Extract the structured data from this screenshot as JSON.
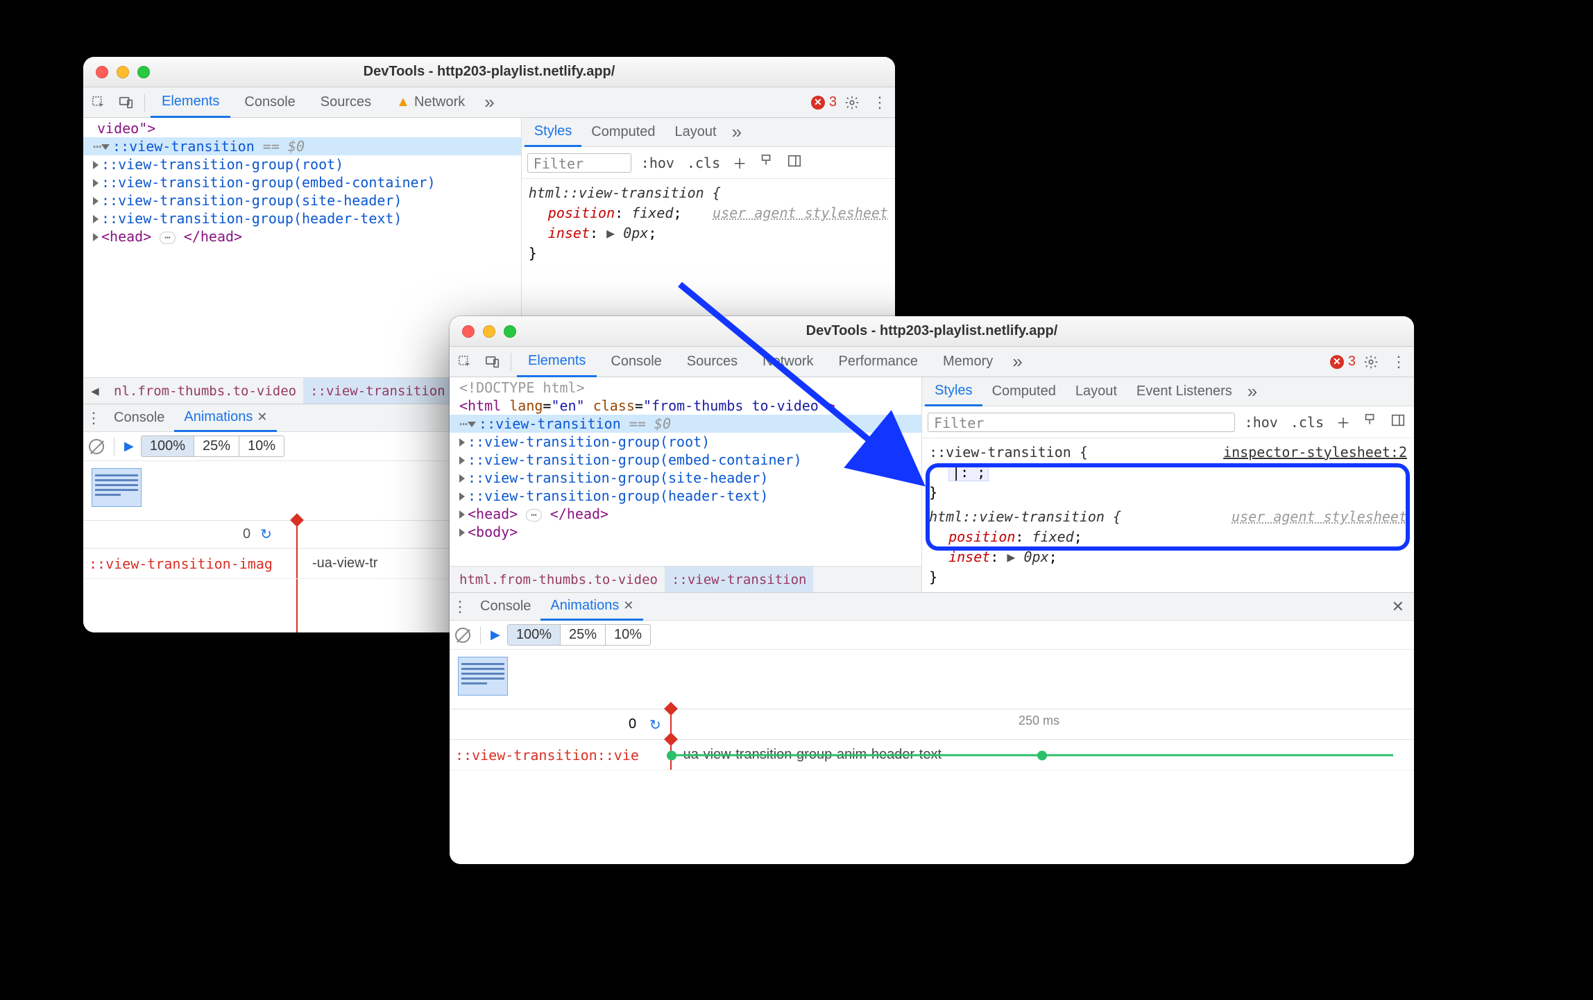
{
  "win1": {
    "title": "DevTools - http203-playlist.netlify.app/",
    "tabs": {
      "elements": "Elements",
      "console": "Console",
      "sources": "Sources",
      "network": "Network"
    },
    "errors": "3",
    "dom": {
      "video_end": "video\">",
      "vt": "::view-transition",
      "dollar": "== $0",
      "g_root": "::view-transition-group(root)",
      "g_embed": "::view-transition-group(embed-container)",
      "g_site": "::view-transition-group(site-header)",
      "g_header": "::view-transition-group(header-text)",
      "head_open": "<head>",
      "head_close": "</head>"
    },
    "crumbs": {
      "c1": "nl.from-thumbs.to-video",
      "c2": "::view-transition"
    },
    "styles": {
      "tab_styles": "Styles",
      "tab_computed": "Computed",
      "tab_layout": "Layout",
      "filter": "Filter",
      "hov": ":hov",
      "cls": ".cls",
      "rule_sel": "html::view-transition {",
      "src": "user agent stylesheet",
      "p1": "position",
      "v1": "fixed",
      "p2": "inset",
      "v2": "0px",
      "close": "}"
    },
    "drawer": {
      "console": "Console",
      "anim": "Animations",
      "seg100": "100%",
      "seg25": "25%",
      "seg10": "10%",
      "zero": "0",
      "row_left": "::view-transition-imag",
      "row_anim": "-ua-view-tr"
    }
  },
  "win2": {
    "title": "DevTools - http203-playlist.netlify.app/",
    "tabs": {
      "elements": "Elements",
      "console": "Console",
      "sources": "Sources",
      "network": "Network",
      "performance": "Performance",
      "memory": "Memory"
    },
    "errors": "3",
    "dom": {
      "doctype": "<!DOCTYPE html>",
      "html_open1": "<html ",
      "lang_attr": "lang",
      "lang_val": "\"en\"",
      "class_attr": "class",
      "class_val": "\"from-thumbs to-video\"",
      "html_open2": ">",
      "vt": "::view-transition",
      "dollar": "== $0",
      "g_root": "::view-transition-group(root)",
      "g_embed": "::view-transition-group(embed-container)",
      "g_site": "::view-transition-group(site-header)",
      "g_header": "::view-transition-group(header-text)",
      "head_open": "<head>",
      "head_close": "</head>",
      "body_open": "<body>"
    },
    "crumbs": {
      "c1": "html.from-thumbs.to-video",
      "c2": "::view-transition"
    },
    "styles": {
      "tab_styles": "Styles",
      "tab_computed": "Computed",
      "tab_layout": "Layout",
      "tab_el": "Event Listeners",
      "filter": "Filter",
      "hov": ":hov",
      "cls": ".cls",
      "r1_sel": "::view-transition {",
      "r1_src": "inspector-stylesheet:2",
      "r1_empty": "|:  ;",
      "r1_close": "}",
      "r2_sel": "html::view-transition {",
      "r2_src": "user agent stylesheet",
      "p1": "position",
      "v1": "fixed",
      "p2": "inset",
      "v2": "0px",
      "close": "}"
    },
    "drawer": {
      "console": "Console",
      "anim": "Animations",
      "seg100": "100%",
      "seg25": "25%",
      "seg10": "10%",
      "zero": "0",
      "tick": "250 ms",
      "row_left": "::view-transition::vie",
      "row_anim": "-ua-view-transition-group-anim-header-text"
    }
  }
}
